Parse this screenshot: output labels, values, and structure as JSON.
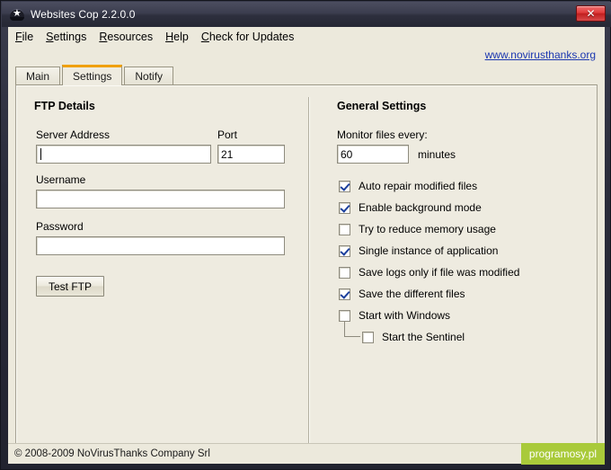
{
  "window": {
    "title": "Websites Cop 2.2.0.0",
    "app_icon": "police-badge-star-icon",
    "close_label": "✕"
  },
  "menubar": {
    "items": [
      {
        "label": "File",
        "accel": "F",
        "rest": "ile"
      },
      {
        "label": "Settings",
        "accel": "S",
        "rest": "ettings"
      },
      {
        "label": "Resources",
        "accel": "R",
        "rest": "esources"
      },
      {
        "label": "Help",
        "accel": "H",
        "rest": "elp"
      },
      {
        "label": "Check for Updates",
        "accel": "C",
        "rest": "heck for Updates"
      }
    ]
  },
  "site_link": {
    "label": "www.novirusthanks.org",
    "color": "#1b37b0"
  },
  "tabs": [
    {
      "label": "Main",
      "active": false
    },
    {
      "label": "Settings",
      "active": true
    },
    {
      "label": "Notify",
      "active": false
    }
  ],
  "ftp_details": {
    "title": "FTP Details",
    "server_address": {
      "label": "Server Address",
      "value": "",
      "focused": true
    },
    "port": {
      "label": "Port",
      "value": "21"
    },
    "username": {
      "label": "Username",
      "value": ""
    },
    "password": {
      "label": "Password",
      "value": ""
    },
    "test_button": {
      "label": "Test FTP"
    }
  },
  "general_settings": {
    "title": "General Settings",
    "monitor_label": "Monitor files every:",
    "monitor_value": "60",
    "monitor_unit": "minutes",
    "checkboxes": [
      {
        "label": "Auto repair modified files",
        "checked": true,
        "nested": false
      },
      {
        "label": "Enable background mode",
        "checked": true,
        "nested": false
      },
      {
        "label": "Try to reduce memory usage",
        "checked": false,
        "nested": false
      },
      {
        "label": "Single instance of application",
        "checked": true,
        "nested": false
      },
      {
        "label": "Save logs only if file was modified",
        "checked": false,
        "nested": false
      },
      {
        "label": "Save the different files",
        "checked": true,
        "nested": false
      },
      {
        "label": "Start with Windows",
        "checked": false,
        "nested": false
      },
      {
        "label": "Start the Sentinel",
        "checked": false,
        "nested": true
      }
    ]
  },
  "statusbar": {
    "copyright": "© 2008-2009 NoVirusThanks Company Srl",
    "watermark": "programosy.pl",
    "watermark_color": "#a9ca3a"
  },
  "theme": {
    "accent_tab": "#f0a000",
    "client_bg": "#ece9dc",
    "panel_bg": "#eeebe0",
    "check_color": "#1b3f9c"
  }
}
